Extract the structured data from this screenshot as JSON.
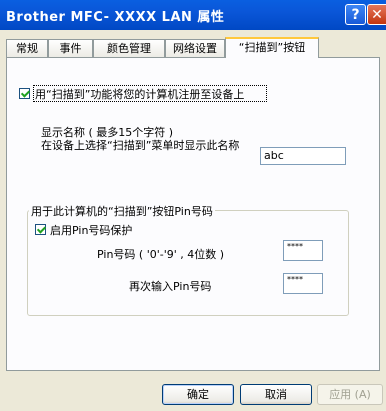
{
  "window": {
    "title": "Brother   MFC- XXXX   LAN  属性",
    "help_label": "?",
    "close_label": "✕"
  },
  "tabs": [
    {
      "label": "常规"
    },
    {
      "label": "事件"
    },
    {
      "label": "颜色管理"
    },
    {
      "label": "网络设置"
    },
    {
      "label": "“扫描到”按钮"
    }
  ],
  "register_checkbox": {
    "label": "用“扫描到”功能将您的计算机注册至设备上",
    "checked": true
  },
  "display_name": {
    "line1": "显示名称 ( 最多15个字符 )",
    "line2": "在设备上选择“扫描到”菜单时显示此名称",
    "value": "abc"
  },
  "pin_group": {
    "title": "用于此计算机的“扫描到”按钮Pin号码",
    "enable_label": "启用Pin号码保护",
    "enable_checked": true,
    "pin_label": "Pin号码 ( '0'-'9' , 4位数 )",
    "pin_value": "****",
    "repeat_label": "再次输入Pin号码",
    "repeat_value": "****"
  },
  "buttons": {
    "ok": "确定",
    "cancel": "取消",
    "apply": "应用 (A)"
  }
}
